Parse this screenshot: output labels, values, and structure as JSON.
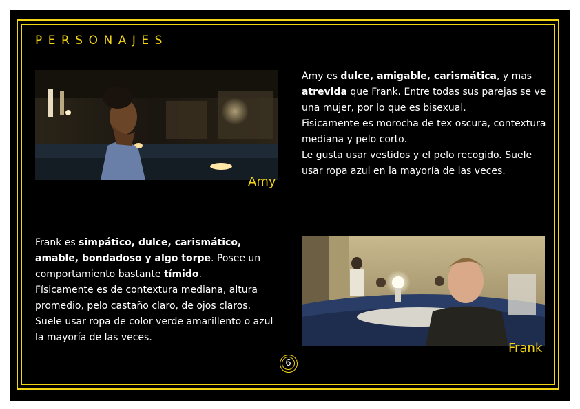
{
  "title": "PERSONAJES",
  "amy": {
    "name": "Amy",
    "photo_icon": "amy-photo",
    "parts": [
      "Amy es ",
      "dulce, amigable, carismática",
      ", y mas ",
      "atrevida",
      " que Frank. Entre todas sus parejas se ve una mujer, por lo que es bisexual.",
      "Fisicamente es morocha de tex oscura, contextura mediana y pelo corto.",
      "Le gusta usar vestidos y el pelo recogido. Suele usar ropa azul en la mayoría de las veces."
    ]
  },
  "frank": {
    "name": "Frank",
    "photo_icon": "frank-photo",
    "parts": [
      "Frank es ",
      "simpático, dulce, carismático, amable, bondadoso y algo torpe",
      ". Posee un comportamiento bastante ",
      "tímido",
      ".",
      "Físicamente es de contextura mediana, altura promedio, pelo castaño claro, de ojos claros.",
      "Suele usar ropa de color verde amarillento o azul la mayoría de las veces."
    ]
  },
  "page_number": "6",
  "colors": {
    "accent": "#f2d513",
    "background": "#000000",
    "text": "#ffffff"
  }
}
